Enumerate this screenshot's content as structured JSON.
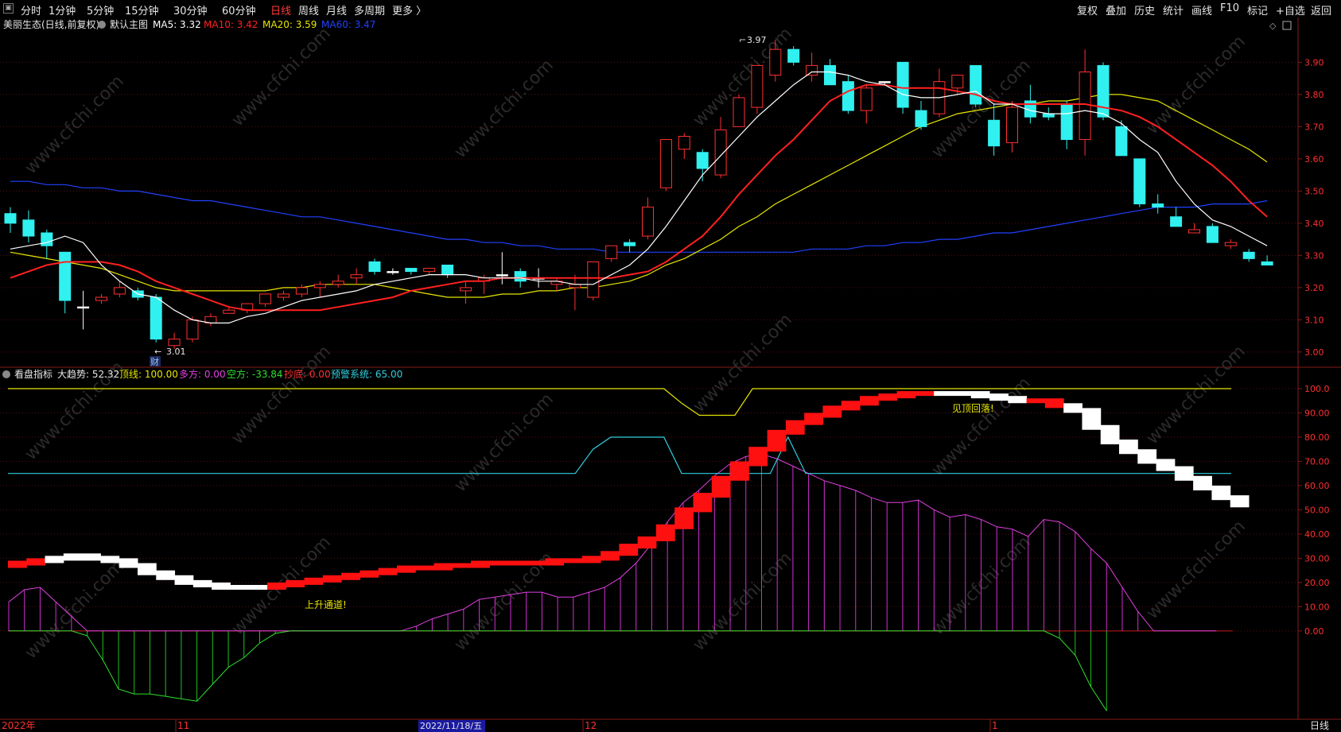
{
  "toolbar_left": [
    "分时",
    "1分钟",
    "5分钟",
    "15分钟",
    "30分钟",
    "60分钟",
    "日线",
    "周线",
    "月线",
    "多周期",
    "更多 〉"
  ],
  "toolbar_active": "日线",
  "toolbar_right": [
    "复权",
    "叠加",
    "历史",
    "统计",
    "画线",
    "F10",
    "标记",
    "+自选",
    "返回"
  ],
  "main_chart": {
    "name": "美丽生态(日线,前复权)",
    "indicator_name": "默认主图",
    "ma5": {
      "label": "MA5: 3.32",
      "color": "#ffffff"
    },
    "ma10": {
      "label": "MA10: 3.42",
      "color": "#ff2020"
    },
    "ma20": {
      "label": "MA20: 3.59",
      "color": "#e6e600"
    },
    "ma60": {
      "label": "MA60: 3.47",
      "color": "#2040ff"
    },
    "high_marker": "3.97",
    "low_marker": "3.01",
    "cai_mark": "财",
    "y_ticks": [
      "3.90",
      "3.80",
      "3.70",
      "3.60",
      "3.50",
      "3.40",
      "3.30",
      "3.20",
      "3.10",
      "3.00"
    ]
  },
  "sub_chart": {
    "name": "看盘指标",
    "items": [
      {
        "label": "大趋势: 52.32",
        "color": "#e6e6e6"
      },
      {
        "label": "顶线: 100.00",
        "color": "#e6e600"
      },
      {
        "label": "多方: 0.00",
        "color": "#e040e0"
      },
      {
        "label": "空方: -33.84",
        "color": "#30e030"
      },
      {
        "label": "抄底: 0.00",
        "color": "#ff3030"
      },
      {
        "label": "预警系统: 65.00",
        "color": "#30d0e0"
      }
    ],
    "annotation_top": "见顶回落!",
    "annotation_bottom": "上升通道!",
    "y_ticks": [
      "100.0",
      "90.00",
      "80.00",
      "70.00",
      "60.00",
      "50.00",
      "40.00",
      "30.00",
      "20.00",
      "10.00",
      "0.00"
    ]
  },
  "x_axis": [
    "2022年",
    "11",
    "2022/11/18/五",
    "12",
    "1"
  ],
  "bottom_right_label": "日线",
  "watermark": "www.cfchi.com",
  "chart_data": [
    {
      "type": "candlestick",
      "title": "美丽生态(日线,前复权)",
      "ylim": [
        2.97,
        3.97
      ],
      "candles": [
        [
          3.43,
          3.45,
          3.37,
          3.4
        ],
        [
          3.41,
          3.44,
          3.34,
          3.36
        ],
        [
          3.37,
          3.38,
          3.29,
          3.33
        ],
        [
          3.31,
          3.31,
          3.12,
          3.16
        ],
        [
          3.14,
          3.19,
          3.07,
          3.14
        ],
        [
          3.16,
          3.18,
          3.15,
          3.17
        ],
        [
          3.18,
          3.22,
          3.17,
          3.2
        ],
        [
          3.19,
          3.2,
          3.16,
          3.17
        ],
        [
          3.17,
          3.18,
          3.03,
          3.04
        ],
        [
          3.02,
          3.06,
          3.01,
          3.04
        ],
        [
          3.04,
          3.11,
          3.03,
          3.1
        ],
        [
          3.09,
          3.12,
          3.08,
          3.11
        ],
        [
          3.12,
          3.14,
          3.12,
          3.13
        ],
        [
          3.13,
          3.15,
          3.12,
          3.15
        ],
        [
          3.15,
          3.18,
          3.14,
          3.18
        ],
        [
          3.17,
          3.19,
          3.16,
          3.18
        ],
        [
          3.18,
          3.21,
          3.17,
          3.2
        ],
        [
          3.2,
          3.22,
          3.17,
          3.21
        ],
        [
          3.21,
          3.24,
          3.2,
          3.22
        ],
        [
          3.23,
          3.26,
          3.21,
          3.24
        ],
        [
          3.28,
          3.29,
          3.24,
          3.25
        ],
        [
          3.25,
          3.26,
          3.24,
          3.25
        ],
        [
          3.26,
          3.26,
          3.24,
          3.25
        ],
        [
          3.25,
          3.26,
          3.24,
          3.26
        ],
        [
          3.27,
          3.27,
          3.23,
          3.24
        ],
        [
          3.19,
          3.22,
          3.15,
          3.2
        ],
        [
          3.22,
          3.24,
          3.18,
          3.23
        ],
        [
          3.24,
          3.31,
          3.21,
          3.24
        ],
        [
          3.25,
          3.26,
          3.2,
          3.22
        ],
        [
          3.23,
          3.26,
          3.2,
          3.23
        ],
        [
          3.21,
          3.23,
          3.19,
          3.22
        ],
        [
          3.2,
          3.24,
          3.13,
          3.21
        ],
        [
          3.17,
          3.28,
          3.16,
          3.28
        ],
        [
          3.29,
          3.33,
          3.28,
          3.33
        ],
        [
          3.34,
          3.35,
          3.31,
          3.33
        ],
        [
          3.36,
          3.48,
          3.35,
          3.45
        ],
        [
          3.51,
          3.66,
          3.5,
          3.66
        ],
        [
          3.63,
          3.68,
          3.6,
          3.67
        ],
        [
          3.62,
          3.63,
          3.53,
          3.57
        ],
        [
          3.55,
          3.73,
          3.54,
          3.69
        ],
        [
          3.7,
          3.8,
          3.7,
          3.79
        ],
        [
          3.76,
          3.89,
          3.74,
          3.89
        ],
        [
          3.86,
          3.97,
          3.84,
          3.94
        ],
        [
          3.94,
          3.95,
          3.89,
          3.9
        ],
        [
          3.86,
          3.93,
          3.84,
          3.89
        ],
        [
          3.89,
          3.91,
          3.83,
          3.83
        ],
        [
          3.84,
          3.86,
          3.74,
          3.75
        ],
        [
          3.75,
          3.83,
          3.71,
          3.82
        ],
        [
          3.84,
          3.84,
          3.83,
          3.84
        ],
        [
          3.9,
          3.9,
          3.74,
          3.76
        ],
        [
          3.75,
          3.78,
          3.69,
          3.7
        ],
        [
          3.74,
          3.88,
          3.73,
          3.84
        ],
        [
          3.82,
          3.86,
          3.8,
          3.86
        ],
        [
          3.89,
          3.89,
          3.76,
          3.77
        ],
        [
          3.72,
          3.77,
          3.61,
          3.64
        ],
        [
          3.65,
          3.78,
          3.62,
          3.76
        ],
        [
          3.78,
          3.83,
          3.71,
          3.73
        ],
        [
          3.74,
          3.76,
          3.72,
          3.73
        ],
        [
          3.77,
          3.78,
          3.63,
          3.66
        ],
        [
          3.66,
          3.94,
          3.61,
          3.87
        ],
        [
          3.89,
          3.9,
          3.72,
          3.73
        ],
        [
          3.7,
          3.72,
          3.61,
          3.61
        ],
        [
          3.6,
          3.6,
          3.45,
          3.46
        ],
        [
          3.46,
          3.49,
          3.43,
          3.45
        ],
        [
          3.42,
          3.45,
          3.39,
          3.39
        ],
        [
          3.37,
          3.4,
          3.37,
          3.38
        ],
        [
          3.39,
          3.4,
          3.34,
          3.34
        ],
        [
          3.33,
          3.35,
          3.32,
          3.34
        ],
        [
          3.31,
          3.32,
          3.28,
          3.29
        ],
        [
          3.28,
          3.3,
          3.27,
          3.27
        ]
      ],
      "ma5": [
        3.32,
        3.33,
        3.34,
        3.36,
        3.34,
        3.27,
        3.22,
        3.18,
        3.17,
        3.13,
        3.1,
        3.09,
        3.09,
        3.11,
        3.12,
        3.14,
        3.16,
        3.17,
        3.18,
        3.19,
        3.21,
        3.22,
        3.23,
        3.24,
        3.24,
        3.24,
        3.23,
        3.23,
        3.23,
        3.22,
        3.22,
        3.21,
        3.21,
        3.24,
        3.27,
        3.32,
        3.39,
        3.47,
        3.55,
        3.61,
        3.67,
        3.73,
        3.78,
        3.83,
        3.87,
        3.87,
        3.86,
        3.84,
        3.83,
        3.8,
        3.79,
        3.79,
        3.8,
        3.81,
        3.77,
        3.77,
        3.75,
        3.74,
        3.74,
        3.75,
        3.74,
        3.71,
        3.66,
        3.62,
        3.53,
        3.46,
        3.41,
        3.39,
        3.36,
        3.33
      ],
      "ma10": [
        3.23,
        3.25,
        3.27,
        3.28,
        3.28,
        3.28,
        3.27,
        3.25,
        3.22,
        3.2,
        3.18,
        3.16,
        3.14,
        3.13,
        3.13,
        3.13,
        3.13,
        3.13,
        3.14,
        3.15,
        3.16,
        3.17,
        3.19,
        3.2,
        3.21,
        3.22,
        3.22,
        3.23,
        3.23,
        3.23,
        3.23,
        3.23,
        3.23,
        3.23,
        3.24,
        3.25,
        3.28,
        3.32,
        3.36,
        3.42,
        3.49,
        3.55,
        3.61,
        3.66,
        3.72,
        3.78,
        3.81,
        3.83,
        3.83,
        3.82,
        3.82,
        3.82,
        3.81,
        3.8,
        3.78,
        3.77,
        3.77,
        3.77,
        3.77,
        3.77,
        3.76,
        3.75,
        3.73,
        3.7,
        3.66,
        3.62,
        3.58,
        3.53,
        3.47,
        3.42
      ],
      "ma20": [
        3.31,
        3.3,
        3.29,
        3.28,
        3.27,
        3.26,
        3.24,
        3.22,
        3.2,
        3.19,
        3.19,
        3.19,
        3.19,
        3.19,
        3.19,
        3.2,
        3.2,
        3.21,
        3.21,
        3.21,
        3.21,
        3.2,
        3.19,
        3.18,
        3.17,
        3.17,
        3.17,
        3.18,
        3.18,
        3.19,
        3.19,
        3.2,
        3.2,
        3.21,
        3.22,
        3.24,
        3.27,
        3.29,
        3.32,
        3.35,
        3.39,
        3.42,
        3.46,
        3.49,
        3.52,
        3.55,
        3.58,
        3.61,
        3.64,
        3.67,
        3.7,
        3.72,
        3.74,
        3.75,
        3.76,
        3.77,
        3.77,
        3.78,
        3.78,
        3.79,
        3.8,
        3.8,
        3.79,
        3.78,
        3.75,
        3.72,
        3.69,
        3.66,
        3.63,
        3.59
      ],
      "ma60": [
        3.53,
        3.53,
        3.52,
        3.52,
        3.51,
        3.51,
        3.5,
        3.5,
        3.49,
        3.48,
        3.47,
        3.47,
        3.46,
        3.45,
        3.44,
        3.43,
        3.42,
        3.42,
        3.41,
        3.4,
        3.39,
        3.38,
        3.37,
        3.36,
        3.35,
        3.35,
        3.34,
        3.34,
        3.33,
        3.33,
        3.32,
        3.32,
        3.32,
        3.31,
        3.31,
        3.31,
        3.31,
        3.31,
        3.31,
        3.31,
        3.31,
        3.31,
        3.31,
        3.31,
        3.32,
        3.32,
        3.32,
        3.33,
        3.33,
        3.34,
        3.34,
        3.35,
        3.35,
        3.36,
        3.37,
        3.37,
        3.38,
        3.39,
        3.4,
        3.41,
        3.42,
        3.43,
        3.44,
        3.45,
        3.45,
        3.45,
        3.46,
        3.46,
        3.46,
        3.47
      ]
    },
    {
      "type": "indicator",
      "title": "看盘指标",
      "ylim": [
        -33.84,
        100
      ],
      "top_line": [
        100,
        100,
        100,
        100,
        100,
        100,
        100,
        100,
        100,
        100,
        100,
        100,
        100,
        100,
        100,
        100,
        100,
        100,
        100,
        100,
        100,
        100,
        100,
        100,
        100,
        100,
        100,
        100,
        100,
        100,
        100,
        100,
        100,
        100,
        100,
        100,
        100,
        100,
        94,
        89,
        89,
        89,
        100,
        100,
        100,
        100,
        100,
        100,
        100,
        100,
        100,
        100,
        100,
        100,
        100,
        100,
        100,
        100,
        100,
        100,
        100,
        100,
        100,
        100,
        100,
        100,
        100,
        100,
        100,
        100
      ],
      "warning_system": [
        65,
        65,
        65,
        65,
        65,
        65,
        65,
        65,
        65,
        65,
        65,
        65,
        65,
        65,
        65,
        65,
        65,
        65,
        65,
        65,
        65,
        65,
        65,
        65,
        65,
        65,
        65,
        65,
        65,
        65,
        65,
        65,
        65,
        75,
        80,
        80,
        80,
        80,
        65,
        65,
        65,
        65,
        65,
        65,
        80,
        65,
        65,
        65,
        65,
        65,
        65,
        65,
        65,
        65,
        65,
        65,
        65,
        65,
        65,
        65,
        65,
        65,
        65,
        65,
        65,
        65,
        65,
        65,
        65,
        65
      ],
      "trend": [
        28,
        29,
        30,
        31,
        30,
        29,
        27,
        24,
        22,
        20,
        19,
        18,
        18,
        18,
        19,
        20,
        21,
        22,
        23,
        24,
        25,
        26,
        26,
        27,
        27,
        28,
        28,
        28,
        28,
        29,
        29,
        30,
        32,
        35,
        38,
        43,
        50,
        56,
        63,
        69,
        75,
        82,
        86,
        89,
        92,
        94,
        96,
        97,
        98,
        98,
        98,
        98,
        97,
        96,
        95,
        95,
        93,
        91,
        84,
        78,
        74,
        70,
        67,
        63,
        59,
        55,
        52
      ],
      "trend_color": [
        "red",
        "red",
        "white",
        "white",
        "white",
        "white",
        "white",
        "white",
        "white",
        "white",
        "white",
        "white",
        "white",
        "white",
        "red",
        "red",
        "red",
        "red",
        "red",
        "red",
        "red",
        "red",
        "red",
        "red",
        "red",
        "red",
        "red",
        "red",
        "red",
        "red",
        "red",
        "red",
        "red",
        "red",
        "red",
        "red",
        "red",
        "red",
        "red",
        "red",
        "red",
        "red",
        "red",
        "red",
        "red",
        "red",
        "red",
        "red",
        "red",
        "red",
        "white",
        "white",
        "white",
        "white",
        "white",
        "red",
        "red",
        "white",
        "white",
        "white",
        "white",
        "white",
        "white",
        "white",
        "white",
        "white",
        "white"
      ],
      "bulls": [
        12,
        17,
        18,
        12,
        6,
        0,
        0,
        0,
        0,
        0,
        0,
        0,
        0,
        0,
        0,
        0,
        0,
        0,
        0,
        0,
        0,
        0,
        0,
        0,
        0,
        0,
        2,
        5,
        7,
        9,
        13,
        14,
        15,
        16,
        16,
        14,
        14,
        16,
        18,
        22,
        28,
        36,
        45,
        53,
        58,
        64,
        69,
        72,
        73,
        71,
        68,
        65,
        62,
        60,
        58,
        55,
        53,
        53,
        54,
        50,
        47,
        48,
        46,
        43,
        42,
        39,
        46,
        45,
        41,
        34,
        28,
        18,
        8,
        0,
        0,
        0,
        0,
        0
      ],
      "bears": [
        0,
        0,
        0,
        0,
        0,
        -2,
        -12,
        -24,
        -26,
        -26,
        -27,
        -28,
        -29,
        -22,
        -15,
        -11,
        -5,
        -1,
        0,
        0,
        0,
        0,
        0,
        0,
        0,
        0,
        0,
        0,
        0,
        0,
        0,
        0,
        0,
        0,
        0,
        0,
        0,
        0,
        0,
        0,
        0,
        0,
        0,
        0,
        0,
        0,
        0,
        0,
        0,
        0,
        0,
        0,
        0,
        0,
        0,
        0,
        0,
        0,
        0,
        0,
        0,
        0,
        0,
        0,
        0,
        0,
        0,
        -3,
        -10,
        -23,
        -33
      ]
    }
  ]
}
